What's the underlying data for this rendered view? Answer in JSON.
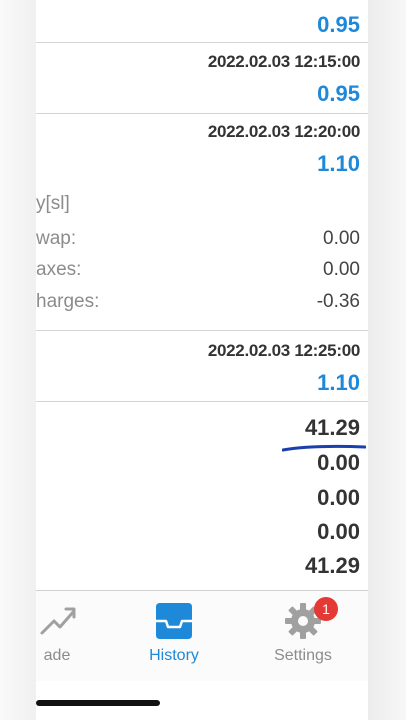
{
  "entries": [
    {
      "date": "",
      "price": "0.95"
    },
    {
      "date": "2022.02.03 12:15:00",
      "price": "0.95"
    },
    {
      "date": "2022.02.03 12:20:00",
      "price": "1.10"
    }
  ],
  "details": {
    "title": "y[sl]",
    "rows": [
      {
        "label": "wap:",
        "value": "0.00"
      },
      {
        "label": "axes:",
        "value": "0.00"
      },
      {
        "label": "harges:",
        "value": "-0.36"
      }
    ]
  },
  "last_entry": {
    "date": "2022.02.03 12:25:00",
    "price": "1.10"
  },
  "summary_values": [
    "41.29",
    "0.00",
    "0.00",
    "0.00",
    "41.29"
  ],
  "tabs": [
    {
      "label": "ade",
      "icon": "trade-icon"
    },
    {
      "label": "History",
      "icon": "inbox-icon"
    },
    {
      "label": "Settings",
      "icon": "gear-icon",
      "badge": "1"
    }
  ],
  "colors": {
    "accent": "#1e88d9",
    "badge": "#e53935",
    "annotation": "#1a3fae",
    "inactive": "#a0a0a0"
  }
}
